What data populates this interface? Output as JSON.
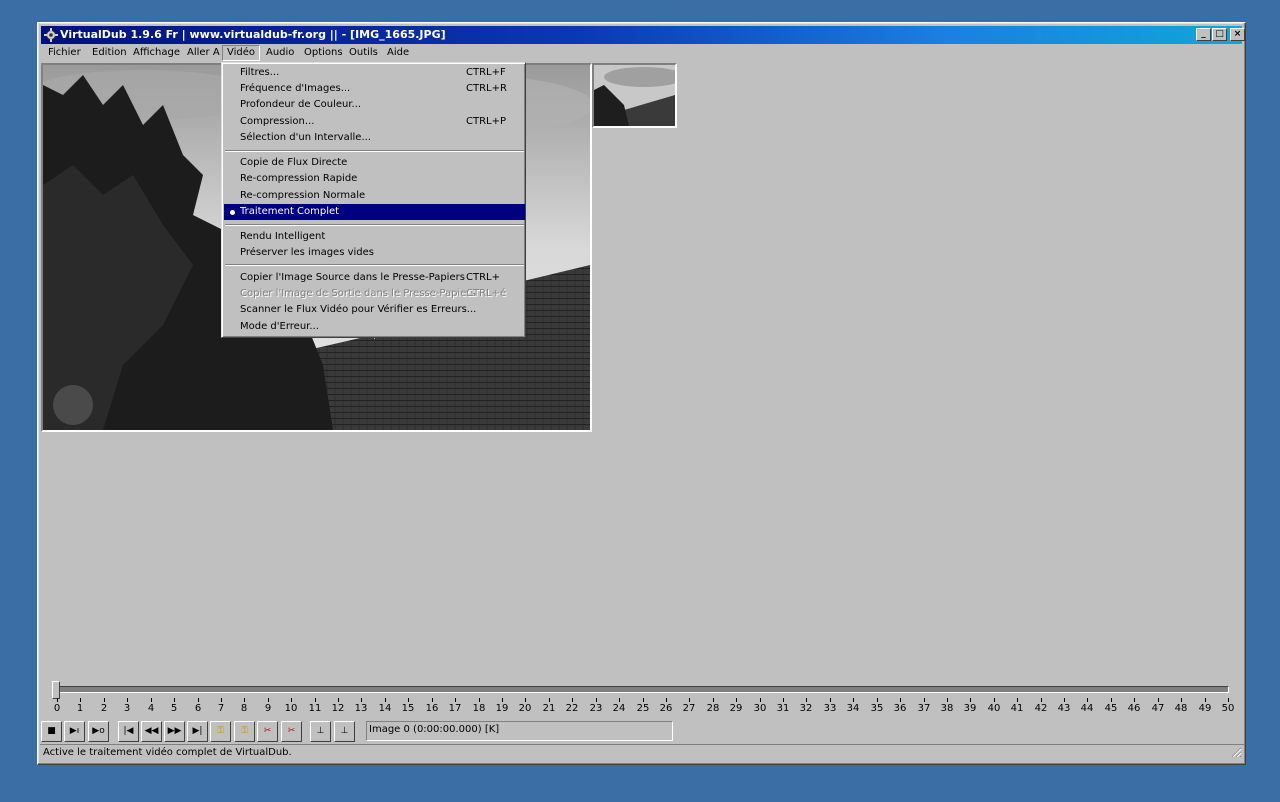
{
  "window": {
    "title": "VirtualDub 1.9.6 Fr | www.virtualdub-fr.org ||  - [IMG_1665.JPG]",
    "buttons": {
      "minimize": "_",
      "maximize": "□",
      "close": "×"
    }
  },
  "menubar": [
    "Fichier",
    "Edition",
    "Affichage",
    "Aller A",
    "Vidéo",
    "Audio",
    "Options",
    "Outils",
    "Aide"
  ],
  "video_menu": {
    "items": [
      {
        "label": "Filtres...",
        "shortcut": "CTRL+F"
      },
      {
        "label": "Fréquence d'Images...",
        "shortcut": "CTRL+R"
      },
      {
        "label": "Profondeur de Couleur...",
        "shortcut": ""
      },
      {
        "label": "Compression...",
        "shortcut": "CTRL+P"
      },
      {
        "label": "Sélection d'un Intervalle...",
        "shortcut": ""
      },
      {
        "label": "Copie de Flux Directe",
        "shortcut": ""
      },
      {
        "label": "Re-compression Rapide",
        "shortcut": ""
      },
      {
        "label": "Re-compression Normale",
        "shortcut": ""
      },
      {
        "label": "Traitement Complet",
        "shortcut": "",
        "selected": true
      },
      {
        "label": "Rendu Intelligent",
        "shortcut": ""
      },
      {
        "label": "Préserver les images vides",
        "shortcut": ""
      },
      {
        "label": "Copier l'Image Source dans le Presse-Papiers",
        "shortcut": "CTRL+"
      },
      {
        "label": "Copier l'Image de Sortie dans le Presse-Papiers",
        "shortcut": "CTRL+é",
        "disabled": true
      },
      {
        "label": "Scanner le Flux Vidéo pour Vérifier es Erreurs...",
        "shortcut": ""
      },
      {
        "label": "Mode d'Erreur...",
        "shortcut": ""
      }
    ]
  },
  "timeline": {
    "min": 0,
    "max": 50,
    "position": 0,
    "ticks": [
      "0",
      "1",
      "2",
      "3",
      "4",
      "5",
      "6",
      "7",
      "8",
      "9",
      "10",
      "11",
      "12",
      "13",
      "14",
      "15",
      "16",
      "17",
      "18",
      "19",
      "20",
      "21",
      "22",
      "23",
      "24",
      "25",
      "26",
      "27",
      "28",
      "29",
      "30",
      "31",
      "32",
      "33",
      "34",
      "35",
      "36",
      "37",
      "38",
      "39",
      "40",
      "41",
      "42",
      "43",
      "44",
      "45",
      "46",
      "47",
      "48",
      "49",
      "50"
    ]
  },
  "toolbar": {
    "icons": [
      "stop-icon",
      "play-input-icon",
      "play-output-icon",
      "go-start-icon",
      "prev-frame-icon",
      "next-frame-icon",
      "go-end-icon",
      "prev-key-icon",
      "next-key-icon",
      "prev-scene-icon",
      "next-scene-icon",
      "mark-in-icon",
      "mark-out-icon"
    ],
    "frame_info": "Image 0 (0:00:00.000) [K]"
  },
  "status": "Active le traitement vidéo complet de VirtualDub.",
  "colors": {
    "desktop": "#3a6ea5",
    "face": "#c0c0c0",
    "highlight": "#000080"
  }
}
